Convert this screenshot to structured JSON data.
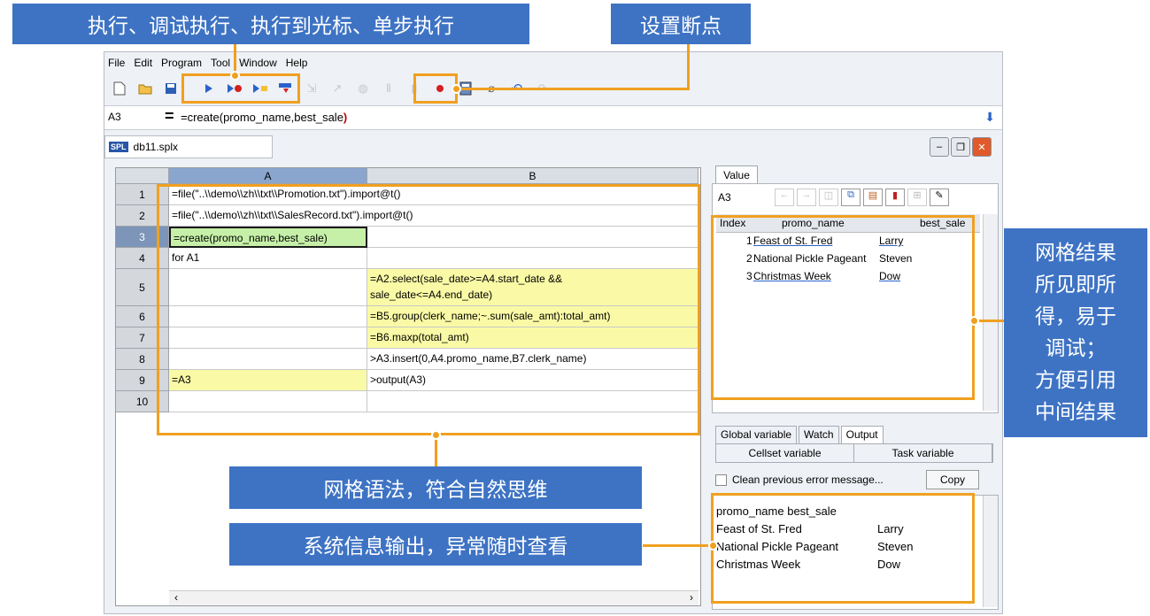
{
  "callouts": {
    "execute": "执行、调试执行、执行到光标、单步执行",
    "breakpoint": "设置断点",
    "grid_result": [
      "网格结果",
      "所见即所",
      "得，易于",
      "调试；",
      "方便引用",
      "中间结果"
    ],
    "grid_syntax": "网格语法，符合自然思维",
    "sys_output": "系统信息输出，异常随时查看"
  },
  "menu": {
    "file": "File",
    "edit": "Edit",
    "program": "Program",
    "tool": "Tool",
    "window": "Window",
    "help": "Help"
  },
  "formula_bar": {
    "cell_ref": "A3",
    "prefix": "=create(",
    "args": "promo_name,best_sale",
    "suffix": ")"
  },
  "tab": {
    "title": "db11.splx",
    "badge": "SPL"
  },
  "grid": {
    "columns": [
      "A",
      "B"
    ],
    "rows": [
      {
        "n": "1",
        "a": "=file(\"..\\\\demo\\\\zh\\\\txt\\\\Promotion.txt\").import@t()",
        "b": ""
      },
      {
        "n": "2",
        "a": "=file(\"..\\\\demo\\\\zh\\\\txt\\\\SalesRecord.txt\").import@t()",
        "b": ""
      },
      {
        "n": "3",
        "a": "=create(promo_name,best_sale)",
        "b": ""
      },
      {
        "n": "4",
        "a": "for A1",
        "b": ""
      },
      {
        "n": "5",
        "a": "",
        "b": "=A2.select(sale_date>=A4.start_date &&",
        "b2": "sale_date<=A4.end_date)"
      },
      {
        "n": "6",
        "a": "",
        "b": "=B5.group(clerk_name;~.sum(sale_amt):total_amt)"
      },
      {
        "n": "7",
        "a": "",
        "b": "=B6.maxp(total_amt)"
      },
      {
        "n": "8",
        "a": "",
        "b": ">A3.insert(0,A4.promo_name,B7.clerk_name)"
      },
      {
        "n": "9",
        "a": "=A3",
        "b": ">output(A3)"
      },
      {
        "n": "10",
        "a": "",
        "b": ""
      }
    ]
  },
  "value_panel": {
    "tab_label": "Value",
    "cell_ref": "A3",
    "headers": [
      "Index",
      "promo_name",
      "best_sale"
    ],
    "rows": [
      {
        "index": "1",
        "promo_name": "Feast of St. Fred",
        "best_sale": "Larry"
      },
      {
        "index": "2",
        "promo_name": "National Pickle Pageant",
        "best_sale": "Steven"
      },
      {
        "index": "3",
        "promo_name": "Christmas Week",
        "best_sale": "Dow"
      }
    ]
  },
  "bottom_panel": {
    "tabs": [
      "Global variable",
      "Watch",
      "Output"
    ],
    "subtabs": [
      "Cellset variable",
      "Task variable"
    ],
    "clear_label": "Clean previous error message...",
    "copy_label": "Copy",
    "output_lines": [
      {
        "c1": "promo_name best_sale",
        "c2": ""
      },
      {
        "c1": "Feast of St. Fred",
        "c2": "Larry"
      },
      {
        "c1": "National Pickle Pageant",
        "c2": "Steven"
      },
      {
        "c1": "Christmas Week",
        "c2": "Dow"
      }
    ]
  },
  "colors": {
    "accent": "#3e73c4",
    "highlight": "#f0a020",
    "yellow_cell": "#fafaa6",
    "selected_cell": "#c6f0a8"
  }
}
